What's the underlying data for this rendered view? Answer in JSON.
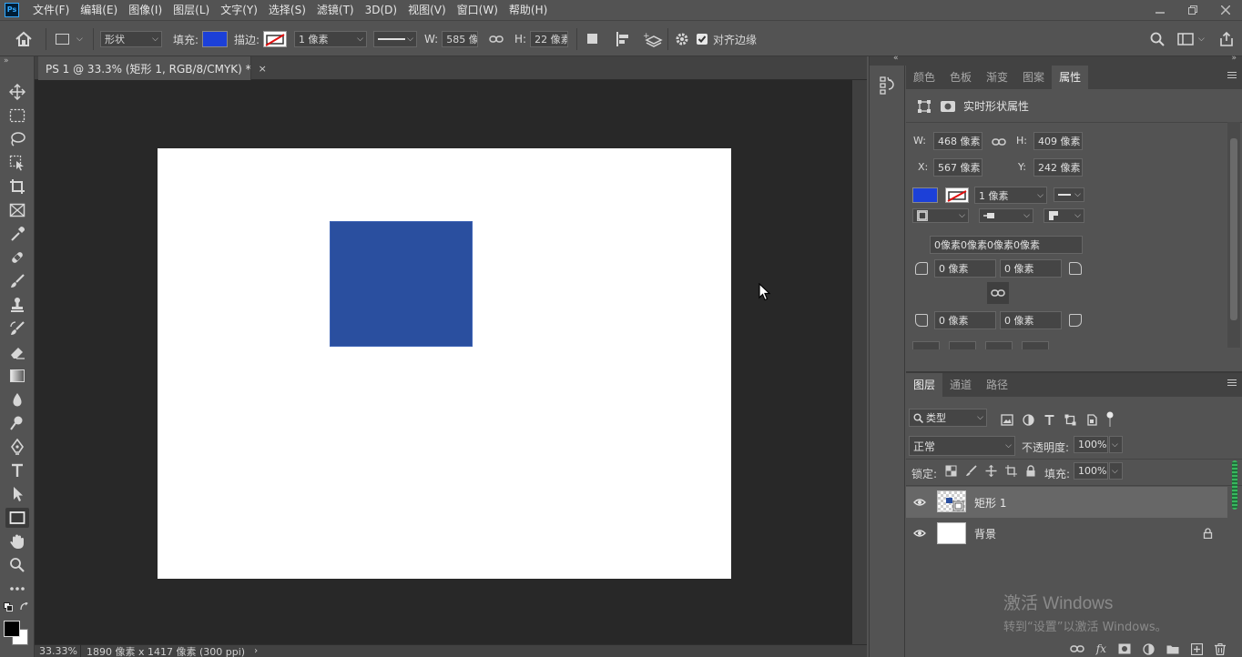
{
  "app": {
    "logo": "Ps"
  },
  "menubar": {
    "items": [
      "文件(F)",
      "编辑(E)",
      "图像(I)",
      "图层(L)",
      "文字(Y)",
      "选择(S)",
      "滤镜(T)",
      "3D(D)",
      "视图(V)",
      "窗口(W)",
      "帮助(H)"
    ]
  },
  "window_controls": {
    "minimize": "minimize-icon",
    "restore": "restore-icon",
    "close": "close-icon"
  },
  "options": {
    "mode": "形状",
    "fill_label": "填充:",
    "fill_color": "#1c40d8",
    "stroke_label": "描边:",
    "stroke_width": "1 像素",
    "w_label": "W:",
    "w_value": "585 像",
    "h_label": "H:",
    "h_value": "22 像素",
    "align_edges_label": "对齐边缘",
    "align_edges_checked": true
  },
  "document": {
    "tab_title": "PS 1 @ 33.3% (矩形 1, RGB/8/CMYK) *",
    "tab_close": "×",
    "shape_color": "#2a4f9f"
  },
  "status": {
    "zoom": "33.33%",
    "dimensions": "1890 像素 x 1417 像素 (300 ppi)",
    "arrow": "›"
  },
  "properties_panel": {
    "tabs": [
      "颜色",
      "色板",
      "渐变",
      "图案",
      "属性"
    ],
    "active_tab": "属性",
    "header": "实时形状属性",
    "w_label": "W:",
    "w_value": "468 像素",
    "h_label": "H:",
    "h_value": "409 像素",
    "x_label": "X:",
    "x_value": "567 像素",
    "y_label": "Y:",
    "y_value": "242 像素",
    "fill_color": "#1c40d8",
    "stroke_width": "1 像素",
    "corners_combined": "0像素0像素0像素0像素",
    "corner_tl": "0 像素",
    "corner_tr": "0 像素",
    "corner_bl": "0 像素",
    "corner_br": "0 像素"
  },
  "layers_panel": {
    "tabs": [
      "图层",
      "通道",
      "路径"
    ],
    "active_tab": "图层",
    "filter_kind": "类型",
    "blend_mode": "正常",
    "opacity_label": "不透明度:",
    "opacity_value": "100%",
    "lock_label": "锁定:",
    "fill_label": "填充:",
    "fill_value": "100%",
    "layers": [
      {
        "name": "矩形 1",
        "selected": true,
        "visible": true,
        "locked": false
      },
      {
        "name": "背景",
        "selected": false,
        "visible": true,
        "locked": true
      }
    ]
  },
  "activation": {
    "title": "激活 Windows",
    "subtitle": "转到“设置”以激活 Windows。"
  }
}
